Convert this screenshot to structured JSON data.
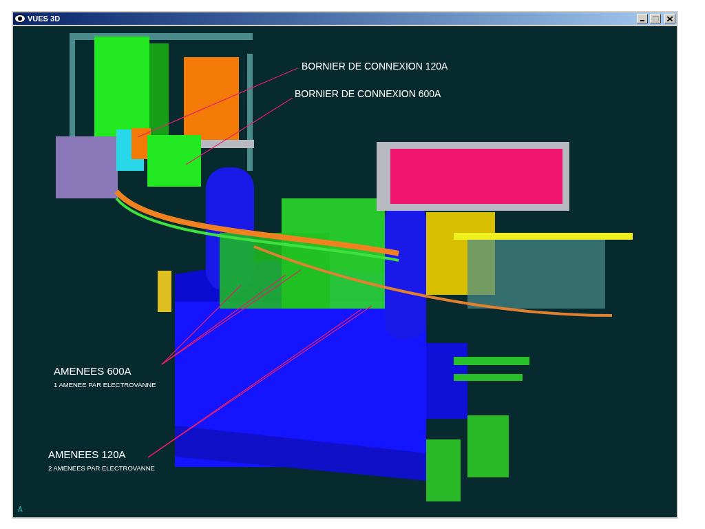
{
  "window": {
    "title": "VUES 3D",
    "maximize_disabled": true
  },
  "callouts": [
    {
      "title": "BORNIER DE CONNEXION 120A"
    },
    {
      "title": "BORNIER DE CONNEXION 600A"
    },
    {
      "title": "AMENEES 600A",
      "note": "1 AMENEE PAR ELECTROVANNE"
    },
    {
      "title": "AMENEES 120A",
      "note": "2 AMENEES PAR ELECTROVANNE"
    }
  ],
  "axis_marker": "A"
}
